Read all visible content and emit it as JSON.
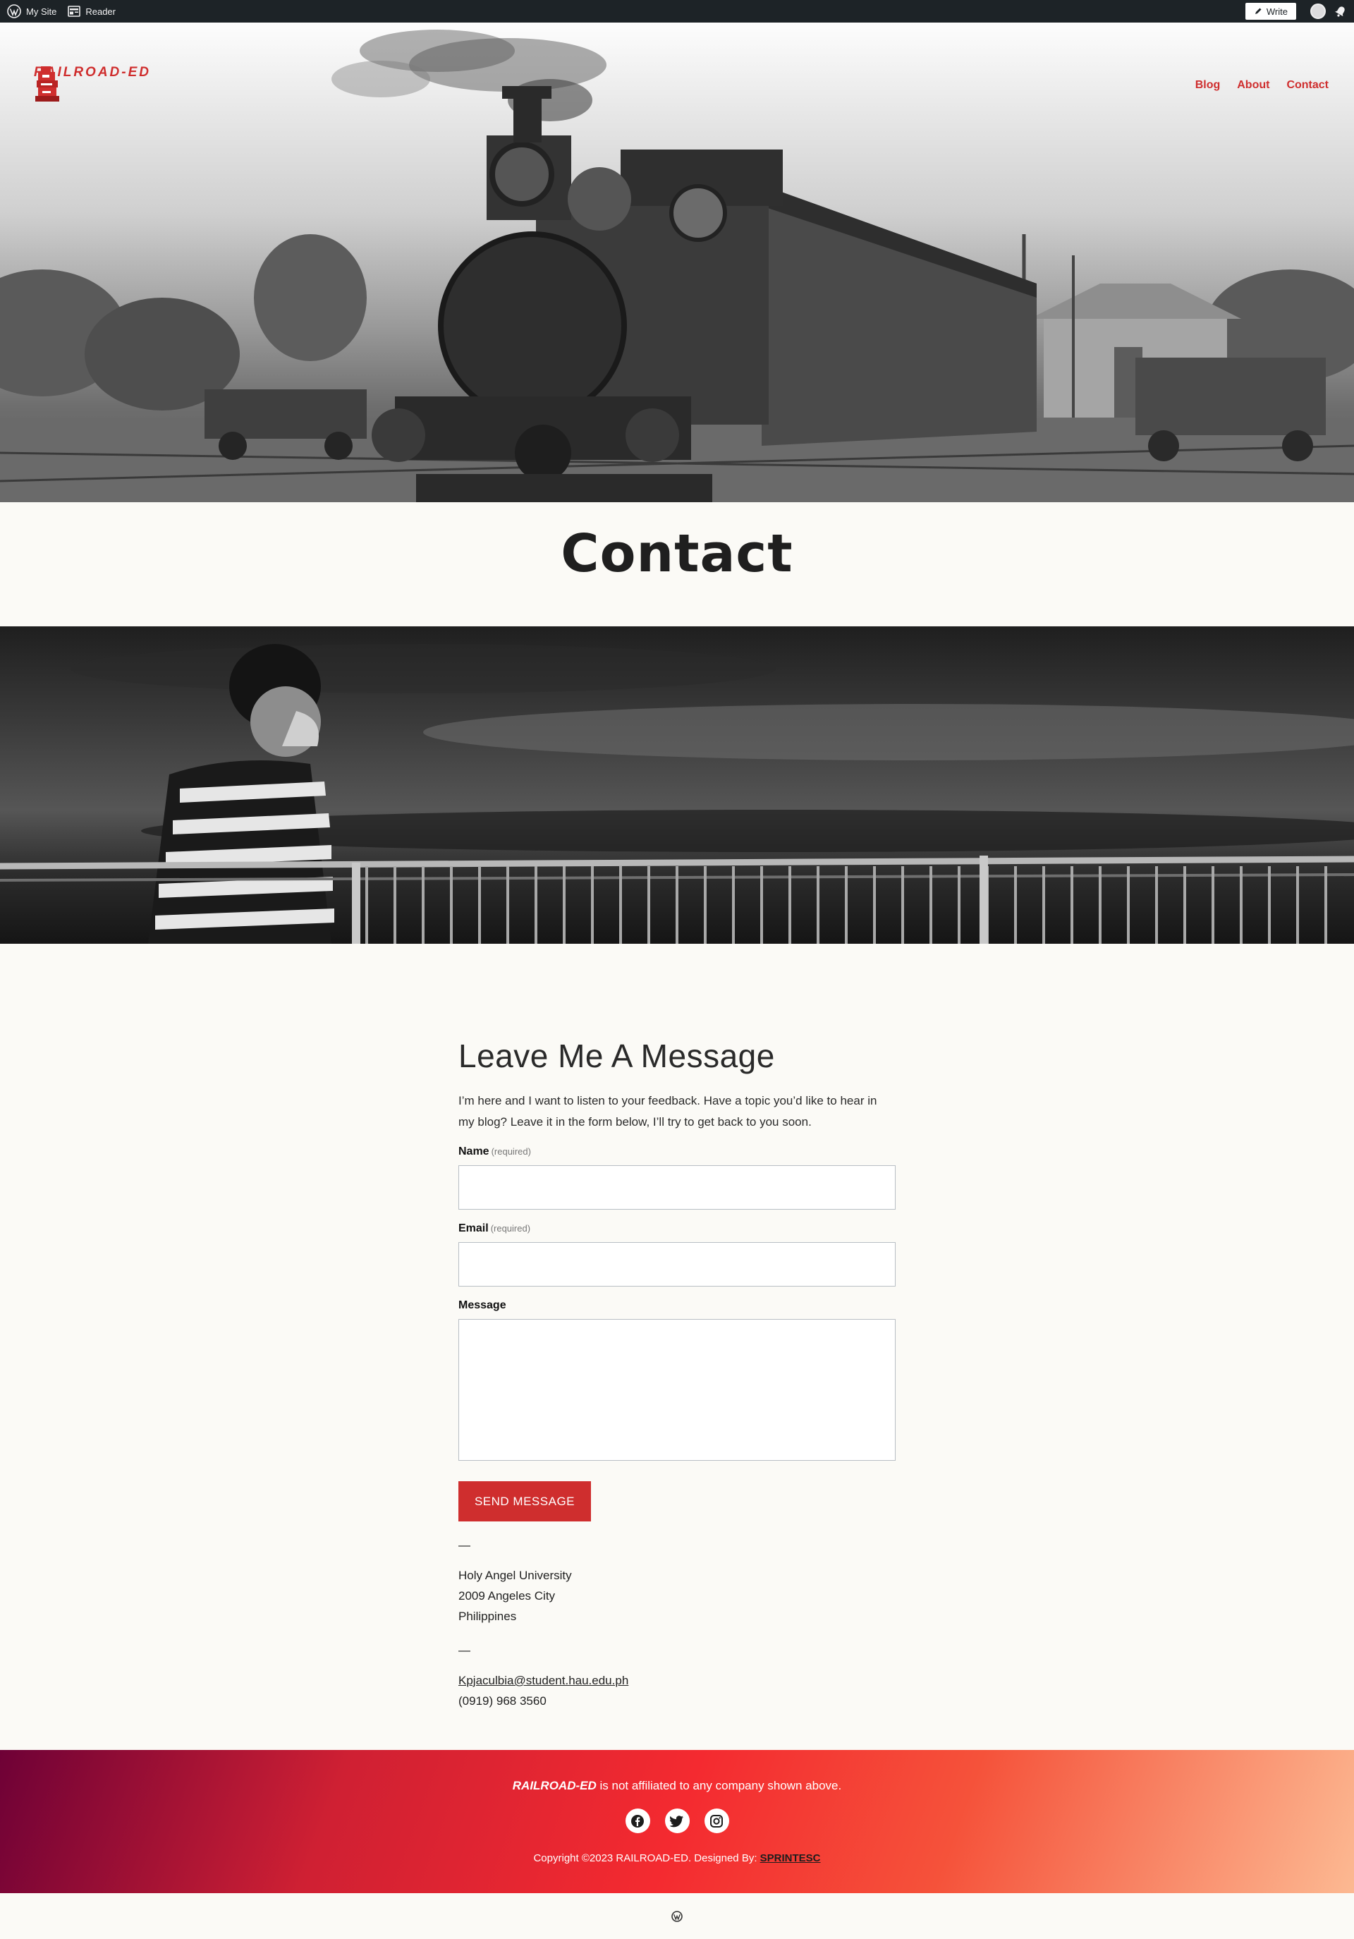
{
  "admin_bar": {
    "my_site": "My Site",
    "reader": "Reader",
    "write": "Write"
  },
  "header": {
    "site_title": "RAILROAD-ED",
    "nav": [
      "Blog",
      "About",
      "Contact"
    ]
  },
  "page": {
    "title": "Contact"
  },
  "form_section": {
    "heading": "Leave Me A Message",
    "intro": "I’m here and I want to listen to your feedback. Have a topic you’d like to hear in my blog? Leave it in the form below, I’ll try to get back to you soon.",
    "name_label": "Name",
    "email_label": "Email",
    "message_label": "Message",
    "required_note": "(required)",
    "submit_label": "SEND MESSAGE"
  },
  "contact_info": {
    "separator": "—",
    "address": [
      "Holy Angel University",
      "2009 Angeles City",
      "Philippines"
    ],
    "email": "Kpjaculbia@student.hau.edu.ph",
    "phone": "(0919) 968 3560"
  },
  "footer": {
    "disclaimer_brand": "RAILROAD-ED",
    "disclaimer_rest": " is not affiliated to any company shown above.",
    "copyright": "Copyright ©2023 RAILROAD-ED. Designed By: ",
    "designer": "SPRINTESC",
    "socials": [
      "facebook-icon",
      "twitter-icon",
      "instagram-icon"
    ]
  },
  "colors": {
    "accent": "#cf2e2e",
    "admin_bar": "#1d2327",
    "page_bg": "#fbfaf6"
  }
}
